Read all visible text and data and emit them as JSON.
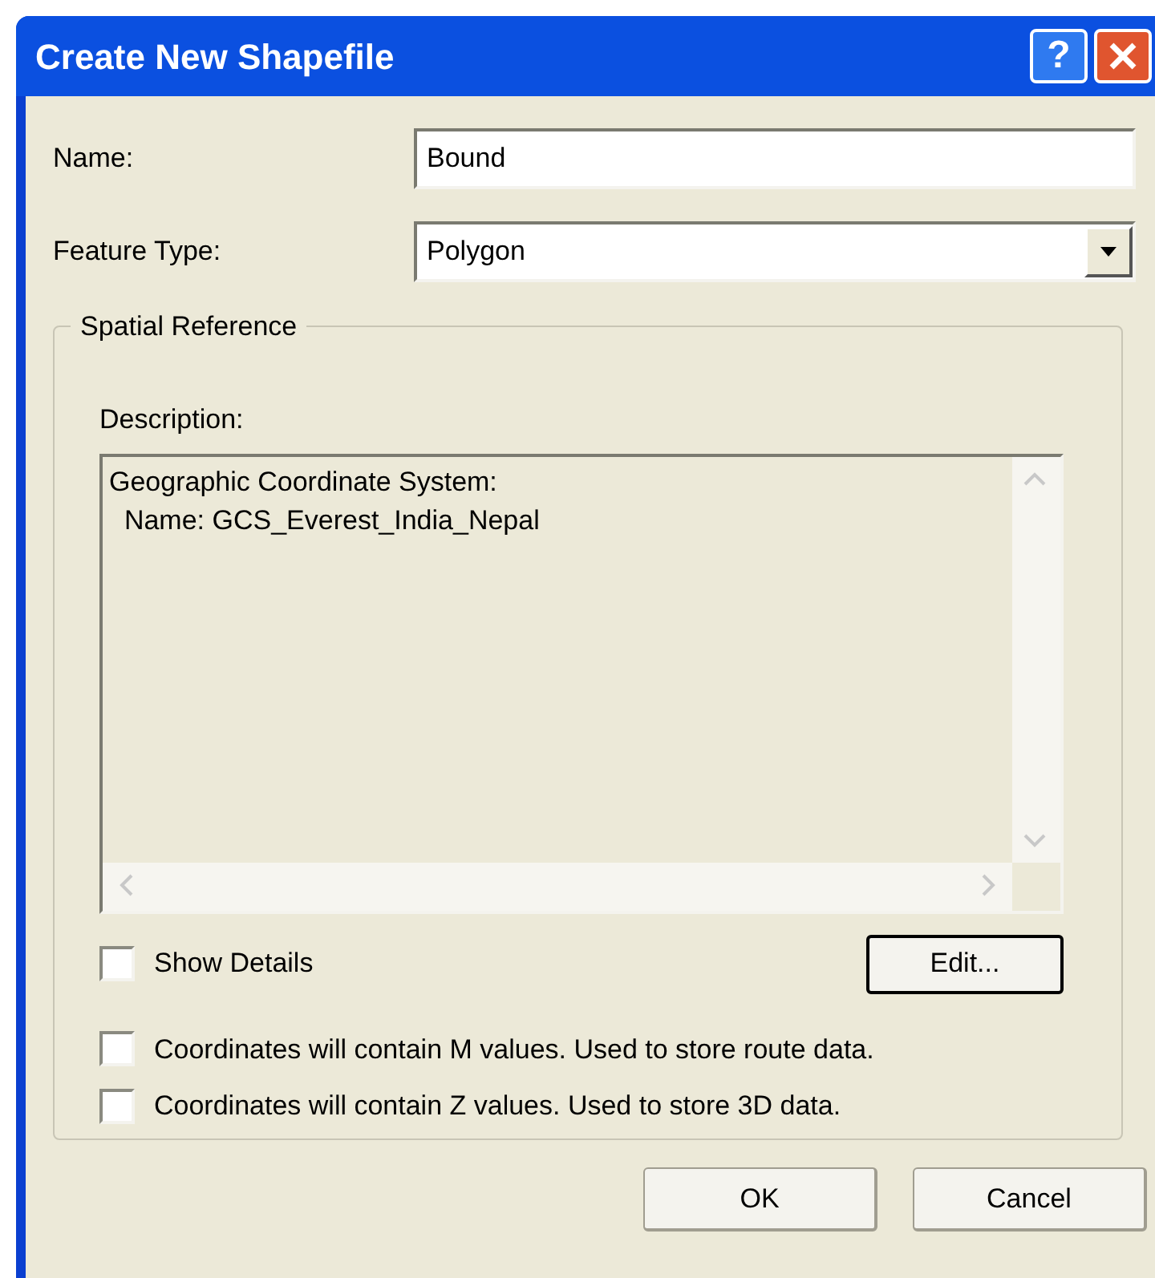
{
  "window": {
    "title": "Create New Shapefile",
    "help_button": "?"
  },
  "name_field": {
    "label": "Name:",
    "value": "Bound"
  },
  "feature_type": {
    "label": "Feature Type:",
    "value": "Polygon"
  },
  "spatial_reference": {
    "title": "Spatial Reference",
    "description_label": "Description:",
    "description_lines": [
      "Geographic Coordinate System:",
      "  Name: GCS_Everest_India_Nepal"
    ],
    "show_details": {
      "label": "Show Details",
      "checked": false
    },
    "edit_button": "Edit..."
  },
  "options": [
    {
      "label": "Coordinates will contain M values. Used to store route data.",
      "checked": false
    },
    {
      "label": "Coordinates will contain Z values. Used to store 3D data.",
      "checked": false
    }
  ],
  "buttons": [
    "OK",
    "Cancel"
  ]
}
